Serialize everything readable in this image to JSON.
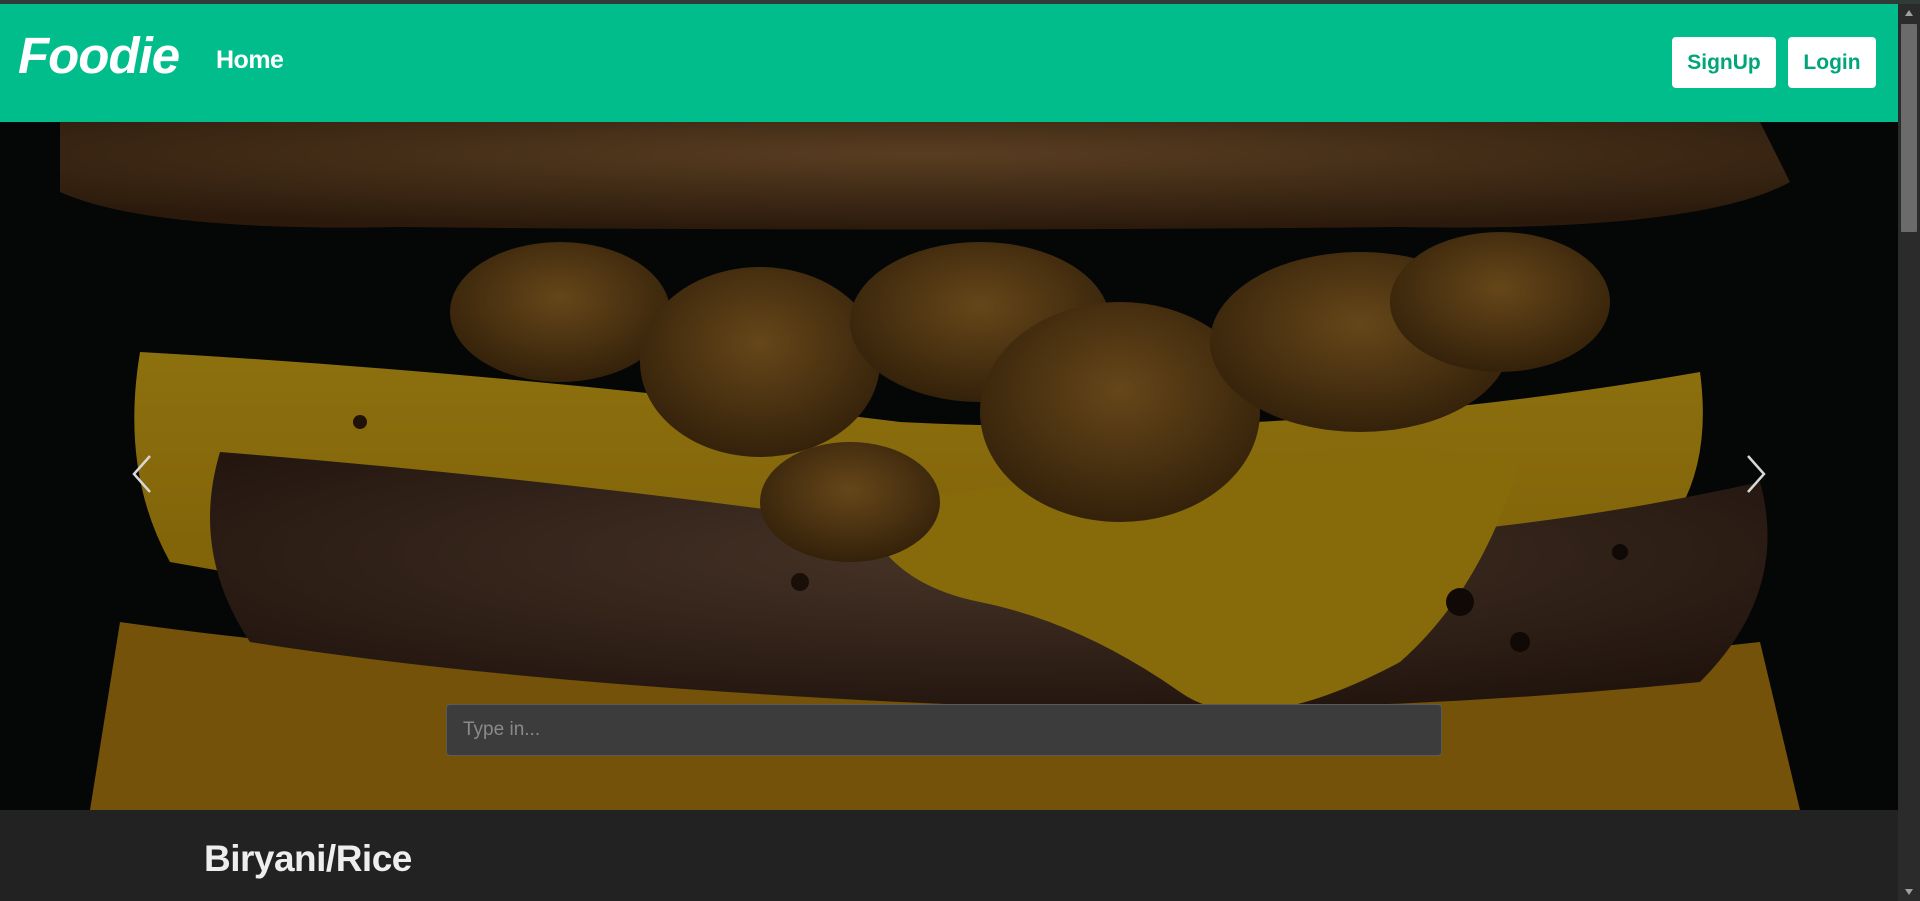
{
  "navbar": {
    "brand": "Foodie",
    "home_label": "Home",
    "signup_label": "SignUp",
    "login_label": "Login"
  },
  "hero": {
    "search_placeholder": "Type in...",
    "search_value": ""
  },
  "section": {
    "title": "Biryani/Rice"
  },
  "icons": {
    "prev": "chevron-left-icon",
    "next": "chevron-right-icon",
    "scroll_up": "caret-up-icon",
    "scroll_down": "caret-down-icon"
  },
  "colors": {
    "navbar_bg": "#00bd8b",
    "button_text": "#00a57a",
    "page_bg": "#222222"
  }
}
